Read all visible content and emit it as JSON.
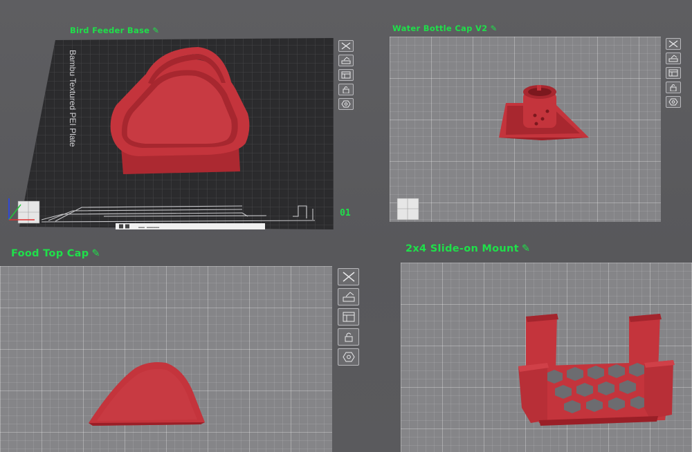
{
  "plates": [
    {
      "title": "Bird Feeder Base",
      "plate_number": "01",
      "bed_label": "Bambu Textured PEI Plate",
      "active": true
    },
    {
      "title": "Water Bottle Cap V2",
      "active": false
    },
    {
      "title": "Food Top Cap",
      "active": false
    },
    {
      "title": "2x4 Slide-on Mount",
      "active": false
    }
  ],
  "toolbar": [
    "close-icon",
    "auto-orient-icon",
    "arrange-icon",
    "lock-icon",
    "settings-icon"
  ],
  "colors": {
    "title_green": "#1fe04a",
    "model_red": "#c4343c",
    "dark_bed": "#2b2b2d",
    "light_bed": "#858588"
  }
}
